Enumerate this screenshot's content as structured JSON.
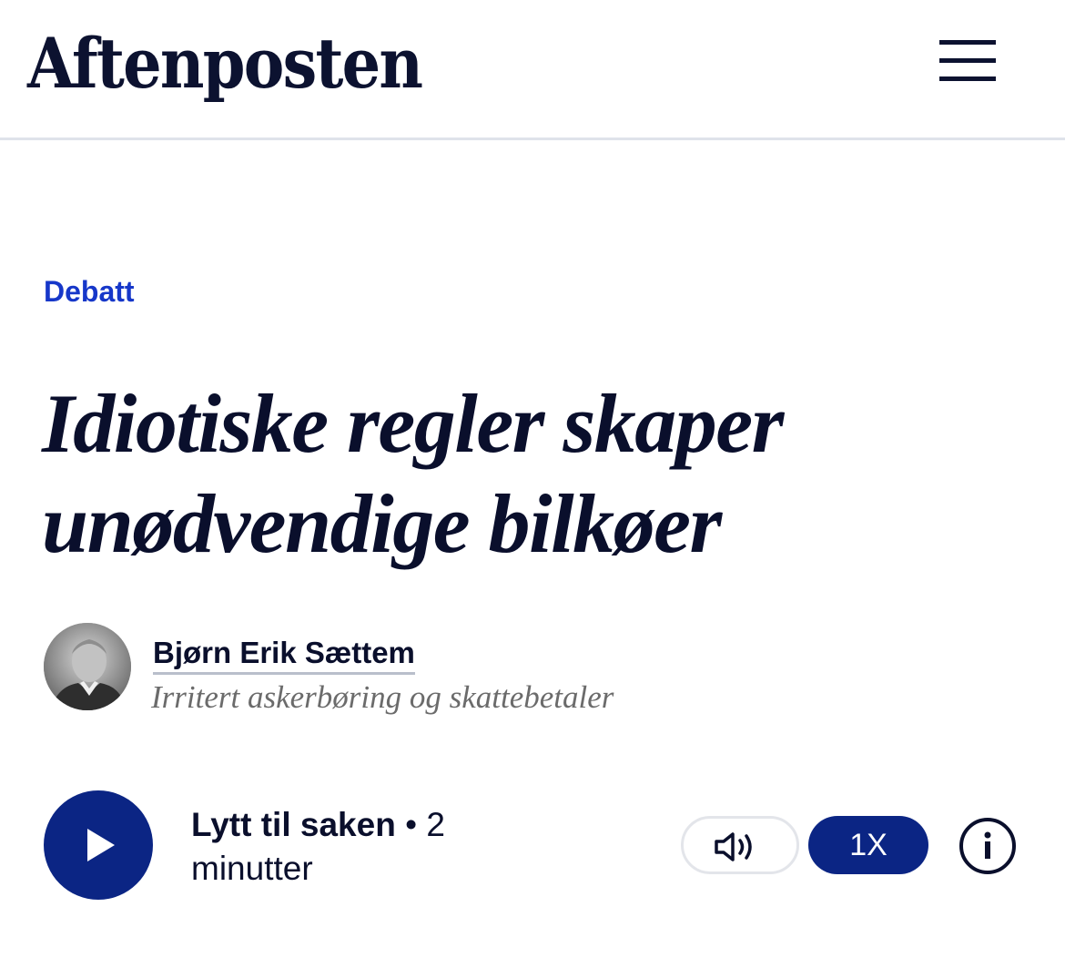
{
  "header": {
    "logo": "Aftenposten",
    "menu_icon": "hamburger-menu-icon"
  },
  "article": {
    "section": "Debatt",
    "headline_line1": "Idiotiske regler skaper",
    "headline_line2": "unødvendige bilkøer",
    "author": {
      "name": "Bjørn Erik Sættem",
      "description": "Irritert askerbøring og skattebetaler"
    }
  },
  "audio": {
    "play_icon": "play-icon",
    "listen_label": "Lytt til saken",
    "duration_prefix": " • 2",
    "duration_unit": "minutter",
    "volume_icon": "volume-icon",
    "speed_label": "1X",
    "info_icon": "info-icon"
  },
  "colors": {
    "navy": "#0b2584",
    "section_blue": "#1637c9",
    "text_dark": "#0a0f2c",
    "muted": "#6b6b6b"
  }
}
